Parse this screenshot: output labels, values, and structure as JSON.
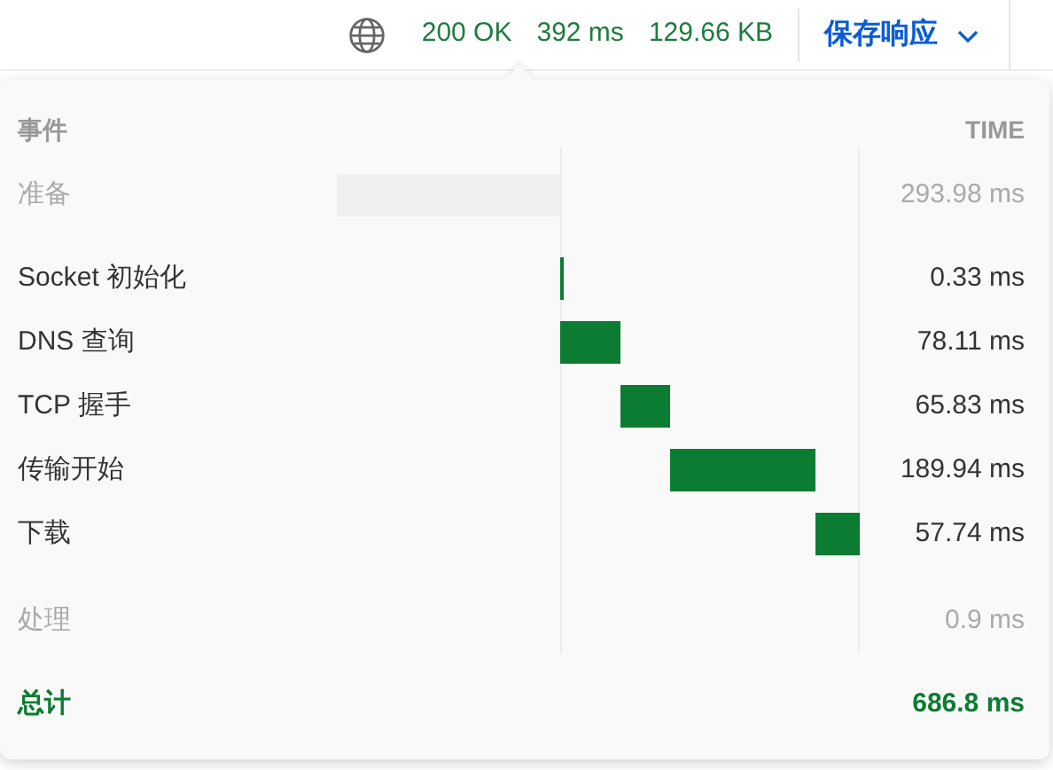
{
  "status_bar": {
    "status": "200 OK",
    "duration": "392 ms",
    "size": "129.66 KB",
    "save_button": "保存响应"
  },
  "timing": {
    "columns": {
      "event": "事件",
      "time": "TIME"
    },
    "groups": [
      {
        "events": [
          {
            "kind": "pending",
            "label": "准备",
            "time": "293.98 ms"
          }
        ]
      },
      {
        "events": [
          {
            "kind": "network",
            "label": "Socket 初始化",
            "time": "0.33 ms"
          },
          {
            "kind": "network",
            "label": "DNS 查询",
            "time": "78.11 ms"
          },
          {
            "kind": "network",
            "label": "TCP 握手",
            "time": "65.83 ms"
          },
          {
            "kind": "network",
            "label": "传输开始",
            "time": "189.94 ms"
          },
          {
            "kind": "network",
            "label": "下载",
            "time": "57.74 ms"
          }
        ]
      },
      {
        "events": [
          {
            "kind": "processing",
            "label": "处理",
            "time": "0.9 ms"
          }
        ]
      }
    ],
    "total": {
      "label": "总计",
      "time": "686.8 ms"
    }
  }
}
